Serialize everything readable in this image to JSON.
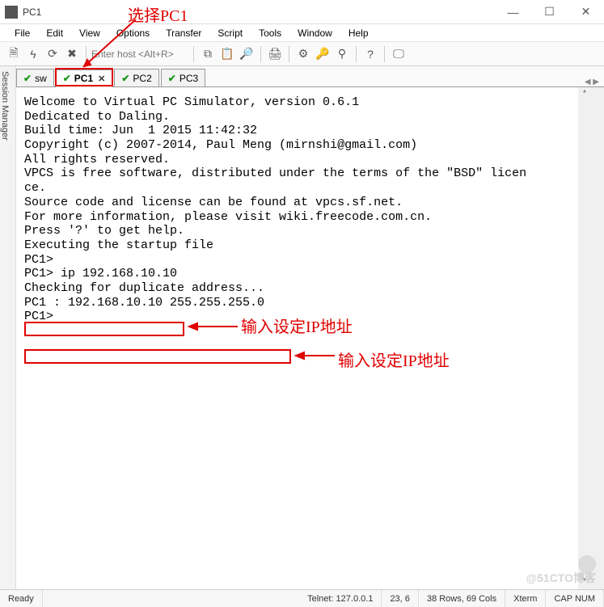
{
  "window": {
    "title": "PC1",
    "min": "—",
    "max": "☐",
    "close": "✕"
  },
  "menu": {
    "items": [
      "File",
      "Edit",
      "View",
      "Options",
      "Transfer",
      "Script",
      "Tools",
      "Window",
      "Help"
    ]
  },
  "toolbar": {
    "host_placeholder": "Enter host <Alt+R>",
    "icons": [
      "sheet",
      "bolt",
      "link",
      "cancel",
      "paste1",
      "paste2",
      "find",
      "print",
      "settings",
      "key",
      "mark",
      "help",
      "screen"
    ]
  },
  "sidepanel": {
    "label": "Session Manager"
  },
  "tabs": {
    "items": [
      {
        "check": "✔",
        "label": "sw"
      },
      {
        "check": "✔",
        "label": "PC1",
        "closable": "✕"
      },
      {
        "check": "✔",
        "label": "PC2"
      },
      {
        "check": "✔",
        "label": "PC3"
      }
    ],
    "arrows": "◀ ▶"
  },
  "terminal": {
    "lines": [
      "",
      "Welcome to Virtual PC Simulator, version 0.6.1",
      "Dedicated to Daling.",
      "Build time: Jun  1 2015 11:42:32",
      "Copyright (c) 2007-2014, Paul Meng (mirnshi@gmail.com)",
      "All rights reserved.",
      "",
      "VPCS is free software, distributed under the terms of the \"BSD\" licen",
      "ce.",
      "Source code and license can be found at vpcs.sf.net.",
      "For more information, please visit wiki.freecode.com.cn.",
      "",
      "Press '?' to get help.",
      "",
      "Executing the startup file",
      "",
      "",
      "PC1>",
      "PC1> ip 192.168.10.10",
      "Checking for duplicate address...",
      "PC1 : 192.168.10.10 255.255.255.0",
      "",
      "PC1>",
      ""
    ]
  },
  "status": {
    "ready": "Ready",
    "telnet": "Telnet: 127.0.0.1",
    "pos": "23,  6",
    "size": "38 Rows, 69 Cols",
    "term": "Xterm",
    "caps": "CAP  NUM"
  },
  "annotations": {
    "a1": "选择PC1",
    "a2": "输入设定IP地址",
    "a3": "输入设定IP地址"
  },
  "watermark": "@51CTO博客"
}
